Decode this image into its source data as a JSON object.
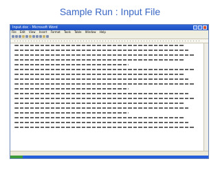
{
  "slide": {
    "title": "Sample Run : Input File"
  },
  "window": {
    "title": "Input.doc - Microsoft Word"
  },
  "menu": [
    "File",
    "Edit",
    "View",
    "Insert",
    "Format",
    "Tools",
    "Table",
    "Window",
    "Help"
  ],
  "document": {
    "line_count": 18
  }
}
